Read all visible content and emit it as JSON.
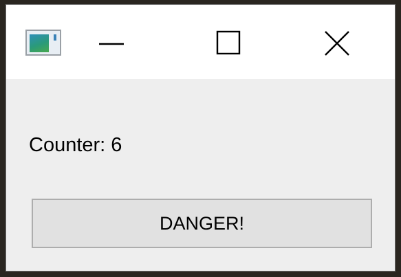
{
  "titlebar": {
    "app_icon": "app-window-icon",
    "buttons": [
      {
        "name": "minimize",
        "icon": "minimize-icon"
      },
      {
        "name": "maximize",
        "icon": "maximize-icon"
      },
      {
        "name": "close",
        "icon": "close-icon"
      }
    ]
  },
  "content": {
    "counter_text": "Counter: 6",
    "danger_button_label": "DANGER!"
  },
  "colors": {
    "titlebar_bg": "#ffffff",
    "content_bg": "#eeeeee",
    "button_bg": "#e1e1e1",
    "button_border": "#adadad"
  }
}
